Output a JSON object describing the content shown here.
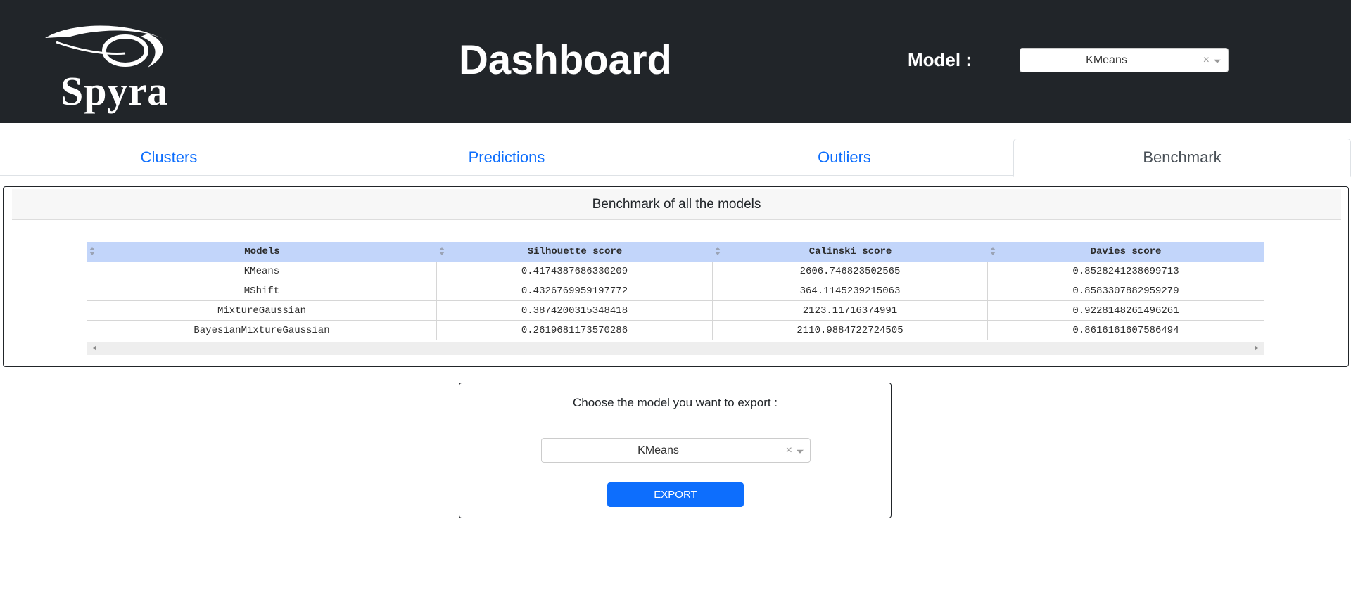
{
  "header": {
    "logo_text": "Spyra",
    "title": "Dashboard",
    "model_label": "Model :",
    "model_select": {
      "value": "KMeans",
      "clear_symbol": "×"
    }
  },
  "tabs": [
    {
      "label": "Clusters",
      "active": false
    },
    {
      "label": "Predictions",
      "active": false
    },
    {
      "label": "Outliers",
      "active": false
    },
    {
      "label": "Benchmark",
      "active": true
    }
  ],
  "benchmark": {
    "title": "Benchmark of all the models",
    "columns": [
      "Models",
      "Silhouette score",
      "Calinski score",
      "Davies score"
    ],
    "rows": [
      [
        "KMeans",
        "0.4174387686330209",
        "2606.746823502565",
        "0.8528241238699713"
      ],
      [
        "MShift",
        "0.4326769959197772",
        "364.1145239215063",
        "0.8583307882959279"
      ],
      [
        "MixtureGaussian",
        "0.3874200315348418",
        "2123.11716374991",
        "0.9228148261496261"
      ],
      [
        "BayesianMixtureGaussian",
        "0.2619681173570286",
        "2110.9884722724505",
        "0.8616161607586494"
      ]
    ]
  },
  "export": {
    "label": "Choose the model you want to export :",
    "select": {
      "value": "KMeans",
      "clear_symbol": "×"
    },
    "button_label": "EXPORT"
  },
  "colors": {
    "header_bg": "#212529",
    "tab_link": "#0d6efd",
    "table_header_bg": "#c2d5fa",
    "button_bg": "#0d6efd"
  }
}
